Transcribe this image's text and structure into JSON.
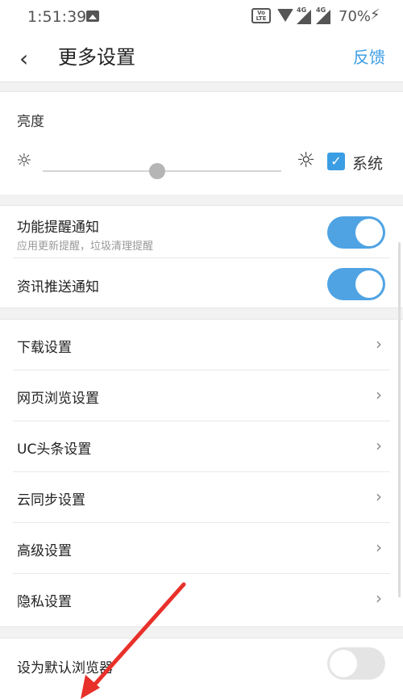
{
  "status_bar": {
    "time": "1:51:39",
    "volte": "VoLTE",
    "net1": "4G",
    "net2": "4G",
    "battery": "70%"
  },
  "header": {
    "title": "更多设置",
    "feedback": "反馈",
    "back_glyph": "‹"
  },
  "brightness": {
    "label": "亮度",
    "level_fraction": 0.48,
    "system_label": "系统",
    "system_checked": true
  },
  "notifications": {
    "feature_title": "功能提醒通知",
    "feature_subtitle": "应用更新提醒，垃圾清理提醒",
    "feature_on": true,
    "news_title": "资讯推送通知",
    "news_on": true
  },
  "settings_list": [
    {
      "label": "下载设置"
    },
    {
      "label": "网页浏览设置"
    },
    {
      "label": "UC头条设置"
    },
    {
      "label": "云同步设置"
    },
    {
      "label": "高级设置"
    },
    {
      "label": "隐私设置"
    }
  ],
  "default_browser": {
    "label": "设为默认浏览器",
    "on": false
  },
  "colors": {
    "accent": "#3b9de3",
    "toggle_on": "#4fa3e3",
    "annotation_arrow": "#e8312a"
  },
  "icons": {
    "sun_low": "☼",
    "sun_high": "☼",
    "check": "✓",
    "chevron": "›",
    "bolt": "⚡"
  }
}
